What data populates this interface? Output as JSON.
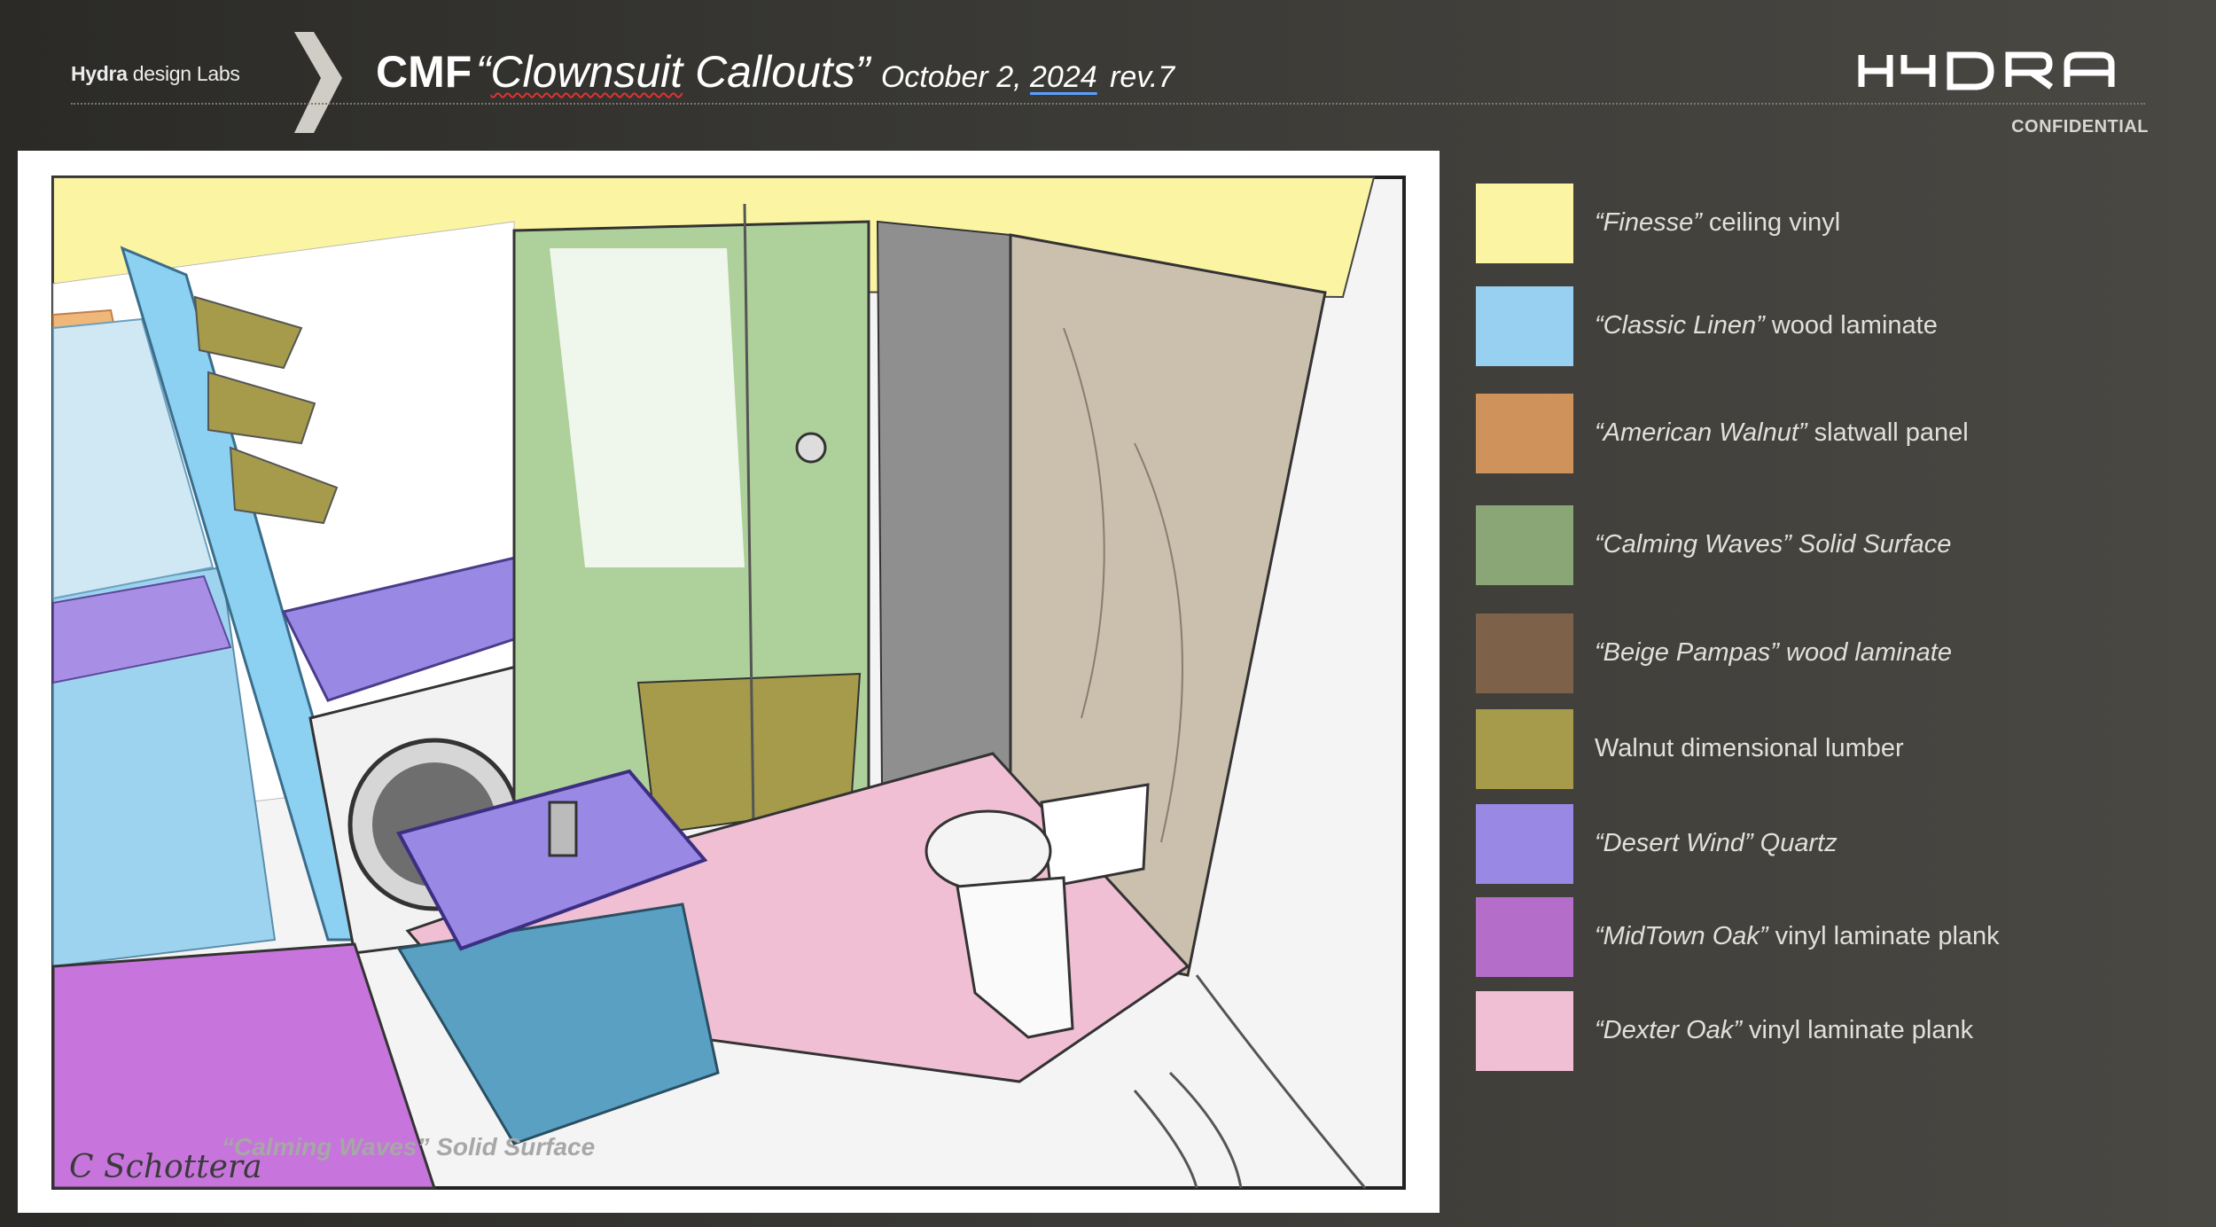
{
  "header": {
    "studio_bold": "Hydra",
    "studio_rest": " design Labs",
    "title_prefix": "CMF",
    "title_name_open": "“",
    "title_name_word": "Clownsuit",
    "title_name_rest": " Callouts”",
    "date_prefix": "October 2, ",
    "date_year": "2024",
    "revision": "rev.7",
    "confidential": "CONFIDENTIAL"
  },
  "render": {
    "caption": "“Calming Waves”  Solid Surface",
    "signature": "C Schottera"
  },
  "legend": [
    {
      "color": "#fbf5a3",
      "name": "“Finesse”",
      "desc": " ceiling vinyl"
    },
    {
      "color": "#97d0f0",
      "name": "“Classic Linen”",
      "desc": "  wood laminate"
    },
    {
      "color": "#cf925b",
      "name": "“American Walnut”",
      "desc": " slatwall panel"
    },
    {
      "color": "#8aa676",
      "name": "“Calming Waves”",
      "desc": "  Solid Surface"
    },
    {
      "color": "#7d6249",
      "name": "“Beige Pampas”",
      "desc": " wood laminate",
      "desc_italic": true
    },
    {
      "color": "#a59b4a",
      "name": "",
      "desc": "Walnut dimensional lumber"
    },
    {
      "color": "#9a89e4",
      "name": "“Desert Wind”",
      "desc": "  Quartz",
      "desc_italic": true
    },
    {
      "color": "#b46dc8",
      "name": "“MidTown Oak”",
      "desc": "  vinyl laminate plank"
    },
    {
      "color": "#f1bfd3",
      "name": "“Dexter Oak”",
      "desc": "  vinyl laminate plank"
    }
  ]
}
